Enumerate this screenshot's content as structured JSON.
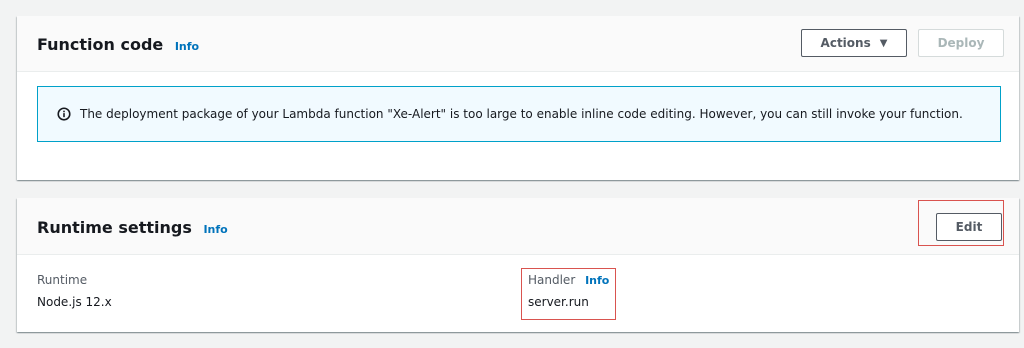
{
  "function_code": {
    "title": "Function code",
    "info_label": "Info",
    "actions_label": "Actions",
    "actions_caret": "▼",
    "deploy_label": "Deploy",
    "alert_icon": "info-circle-icon",
    "alert_message": "The deployment package of your Lambda function \"Xe-Alert\" is too large to enable inline code editing. However, you can still invoke your function."
  },
  "runtime_settings": {
    "title": "Runtime settings",
    "info_label": "Info",
    "edit_label": "Edit",
    "runtime_label": "Runtime",
    "runtime_value": "Node.js 12.x",
    "handler_label": "Handler",
    "handler_info_label": "Info",
    "handler_value": "server.run"
  },
  "colors": {
    "info_link": "#0073bb",
    "alert_border": "#00a1c9",
    "alert_background": "#f1faff",
    "highlight": "#d9534f"
  }
}
